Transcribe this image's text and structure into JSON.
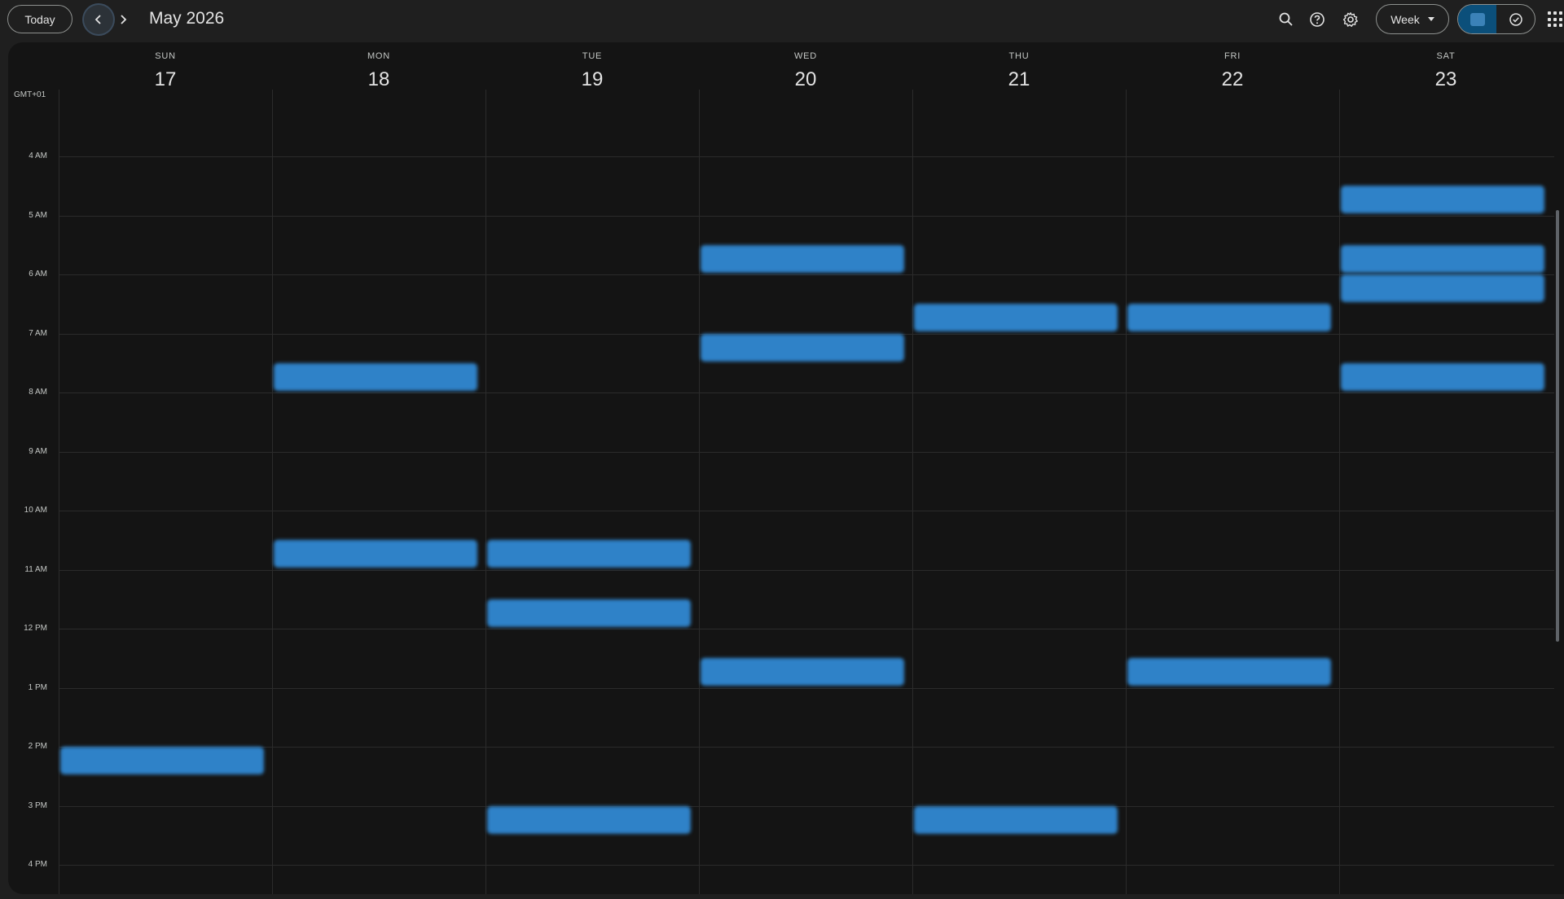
{
  "topbar": {
    "today_label": "Today",
    "month_title": "May 2026",
    "view_label": "Week",
    "icons": [
      "chevron-left-icon",
      "chevron-right-icon",
      "search-icon",
      "help-icon",
      "gear-icon",
      "calendar-icon",
      "task-check-icon",
      "apps-grid-icon"
    ]
  },
  "calendar": {
    "timezone": "GMT+01",
    "days": [
      {
        "dow": "SUN",
        "date": "17"
      },
      {
        "dow": "MON",
        "date": "18"
      },
      {
        "dow": "TUE",
        "date": "19"
      },
      {
        "dow": "WED",
        "date": "20"
      },
      {
        "dow": "THU",
        "date": "21"
      },
      {
        "dow": "FRI",
        "date": "22"
      },
      {
        "dow": "SAT",
        "date": "23"
      }
    ],
    "hours": [
      "4 AM",
      "5 AM",
      "6 AM",
      "7 AM",
      "8 AM",
      "9 AM",
      "10 AM",
      "11 AM",
      "12 PM",
      "1 PM",
      "2 PM",
      "3 PM",
      "4 PM"
    ],
    "event_color": "#2f82c8",
    "events": [
      {
        "day": 6,
        "start": 4.5,
        "title": "",
        "time": ""
      },
      {
        "day": 3,
        "start": 5.5,
        "title": "",
        "time": ""
      },
      {
        "day": 6,
        "start": 5.5,
        "title": "",
        "time": ""
      },
      {
        "day": 6,
        "start": 6.0,
        "title": "",
        "time": ""
      },
      {
        "day": 4,
        "start": 6.5,
        "title": "",
        "time": ""
      },
      {
        "day": 5,
        "start": 6.5,
        "title": "",
        "time": ""
      },
      {
        "day": 3,
        "start": 7.0,
        "title": "",
        "time": ""
      },
      {
        "day": 1,
        "start": 7.5,
        "title": "",
        "time": ""
      },
      {
        "day": 6,
        "start": 7.5,
        "title": "",
        "time": ""
      },
      {
        "day": 1,
        "start": 10.5,
        "title": "",
        "time": ""
      },
      {
        "day": 2,
        "start": 10.5,
        "title": "",
        "time": ""
      },
      {
        "day": 2,
        "start": 11.5,
        "title": "",
        "time": ""
      },
      {
        "day": 3,
        "start": 12.5,
        "title": "",
        "time": ""
      },
      {
        "day": 5,
        "start": 12.5,
        "title": "",
        "time": ""
      },
      {
        "day": 0,
        "start": 14.0,
        "title": "",
        "time": ""
      },
      {
        "day": 2,
        "start": 15.0,
        "title": "",
        "time": ""
      },
      {
        "day": 4,
        "start": 15.0,
        "title": "",
        "time": ""
      }
    ]
  }
}
